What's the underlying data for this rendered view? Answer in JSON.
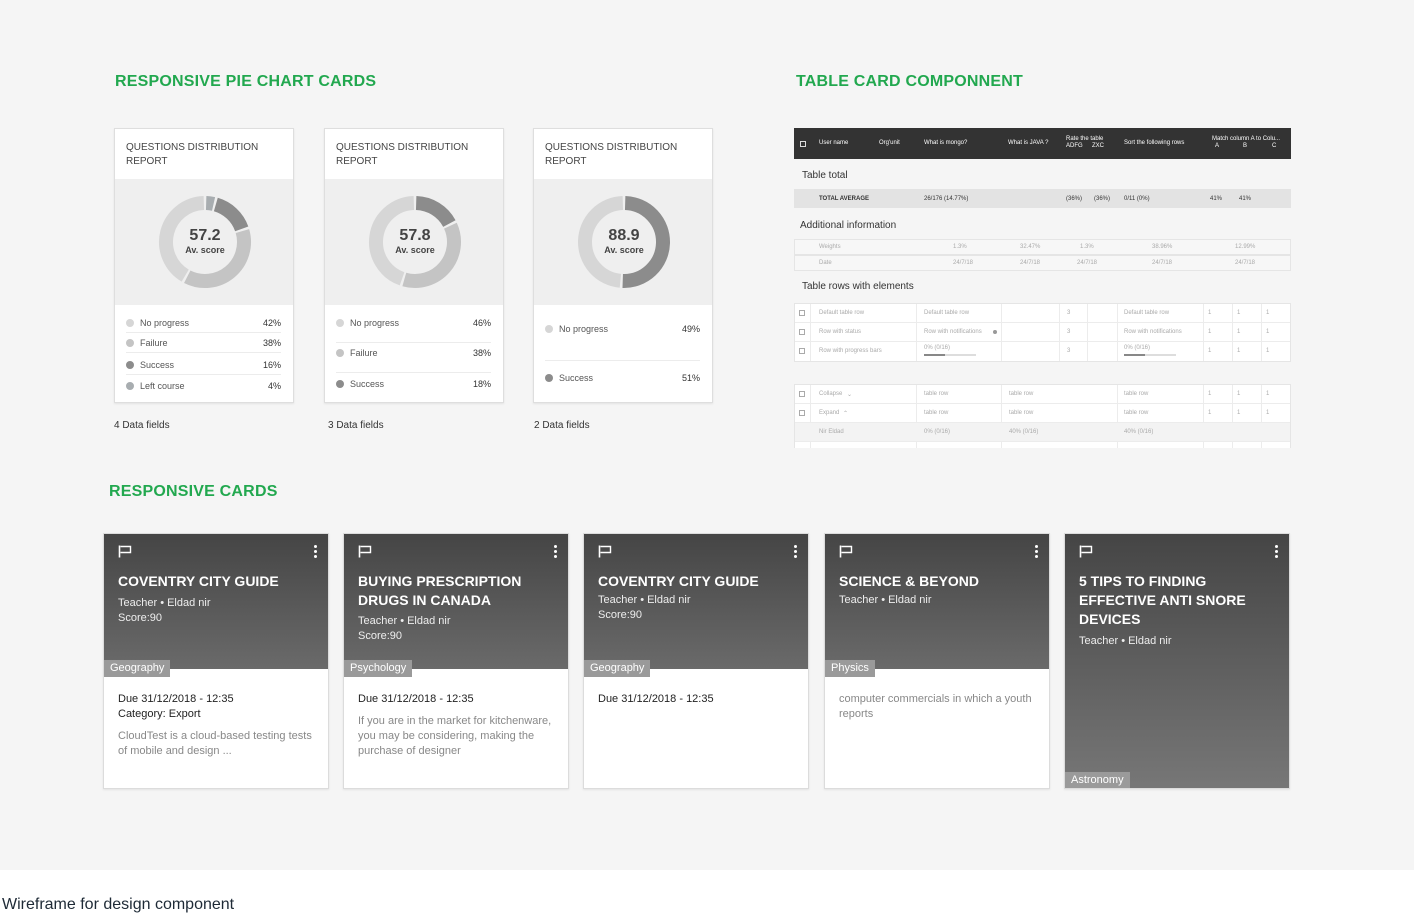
{
  "footer_title": "Wireframe for design component",
  "sections": {
    "pie": "RESPONSIVE PIE CHART CARDS",
    "table": "TABLE CARD COMPONNENT",
    "cards": "RESPONSIVE CARDS"
  },
  "pie_cards": [
    {
      "title": "QUESTIONS DISTRIBUTION REPORT",
      "score": "57.2",
      "score_label": "Av. score",
      "caption": "4 Data fields",
      "legend": [
        {
          "label": "No progress",
          "pct": "42%",
          "value": 42,
          "color": "#d6d6d6"
        },
        {
          "label": "Failure",
          "pct": "38%",
          "value": 38,
          "color": "#c4c4c4"
        },
        {
          "label": "Success",
          "pct": "16%",
          "value": 16,
          "color": "#8c8c8c"
        },
        {
          "label": "Left course",
          "pct": "4%",
          "value": 4,
          "color": "#a8adb0"
        }
      ]
    },
    {
      "title": "QUESTIONS DISTRIBUTION REPORT",
      "score": "57.8",
      "score_label": "Av. score",
      "caption": "3 Data fields",
      "legend": [
        {
          "label": "No progress",
          "pct": "46%",
          "value": 46,
          "color": "#d6d6d6"
        },
        {
          "label": "Failure",
          "pct": "38%",
          "value": 38,
          "color": "#c4c4c4"
        },
        {
          "label": "Success",
          "pct": "18%",
          "value": 18,
          "color": "#8c8c8c"
        }
      ]
    },
    {
      "title": "QUESTIONS DISTRIBUTION REPORT",
      "score": "88.9",
      "score_label": "Av. score",
      "caption": "2 Data fields",
      "legend": [
        {
          "label": "No progress",
          "pct": "49%",
          "value": 49,
          "color": "#d6d6d6"
        },
        {
          "label": "Success",
          "pct": "51%",
          "value": 51,
          "color": "#8c8c8c"
        }
      ]
    }
  ],
  "table_card": {
    "headers": [
      "User name",
      "Org'unit",
      "What is mongo?",
      "What is JAVA ?",
      "Rate the table",
      "ADFG",
      "ZXC",
      "Sort the following rows",
      "Match column A to Colu...",
      "A",
      "B",
      "C"
    ],
    "section_total": "Table total",
    "total_row": [
      "TOTAL AVERAGE",
      "26/176 (14.77%)",
      "(36%)",
      "(36%)",
      "0/11 (0%)",
      "41%",
      "41%"
    ],
    "section_info": "Additional information",
    "info_rows": [
      [
        "Weights",
        "1.3%",
        "32.47%",
        "1.3%",
        "38.96%",
        "12.99%"
      ],
      [
        "Date",
        "24/7/18",
        "24/7/18",
        "24/7/18",
        "24/7/18",
        "24/7/18"
      ]
    ],
    "section_elements": "Table rows with elements",
    "element_rows": [
      [
        "Default table row",
        "Default table row",
        "3",
        "Default table row",
        "1",
        "1",
        "1"
      ],
      [
        "Row with status",
        "Row with notifications",
        "3",
        "Row with notifications",
        "1",
        "1",
        "1"
      ],
      [
        "Row with progress bars",
        "0% (0/16)",
        "3",
        "0% (0/16)",
        "1",
        "1",
        "1"
      ]
    ],
    "collapse_rows": [
      [
        "Collapse",
        "table row",
        "table row",
        "table row",
        "1",
        "1",
        "1"
      ],
      [
        "Expand",
        "table row",
        "table row",
        "table row",
        "1",
        "1",
        "1"
      ],
      [
        "Nir Eldad",
        "0% (0/16)",
        "40% (0/16)",
        "40% (0/16)"
      ]
    ]
  },
  "cards": [
    {
      "title": "COVENTRY CITY GUIDE",
      "meta1": "Teacher • Eldad nir",
      "meta2": "Score:90",
      "tag": "Geography",
      "due": "Due 31/12/2018 - 12:35",
      "category": "Category: Export",
      "desc": "CloudTest is a cloud-based testing tests of mobile and design ..."
    },
    {
      "title": "BUYING PRESCRIPTION DRUGS IN CANADA",
      "meta1": "Teacher • Eldad nir",
      "meta2": "Score:90",
      "tag": "Psychology",
      "due": "Due 31/12/2018 - 12:35",
      "category": "",
      "desc": "If you are in the market for kitchenware, you may be considering, making the purchase of designer"
    },
    {
      "title": "COVENTRY CITY GUIDE",
      "meta1": "Teacher • Eldad nir",
      "meta2": "Score:90",
      "tag": "Geography",
      "due": "Due 31/12/2018 - 12:35",
      "category": "",
      "desc": ""
    },
    {
      "title": "SCIENCE & BEYOND",
      "meta1": "Teacher • Eldad nir",
      "meta2": "",
      "tag": "Physics",
      "due": "",
      "category": "",
      "desc": "computer commercials in which a youth reports"
    },
    {
      "title": "5 TIPS TO FINDING EFFECTIVE ANTI SNORE DEVICES",
      "meta1": "Teacher • Eldad nir",
      "meta2": "",
      "tag": "Astronomy",
      "due": "",
      "category": "",
      "desc": ""
    }
  ],
  "icons": {
    "card_flag": "flag-icon",
    "card_menu": "kebab-menu-icon",
    "checkbox": "checkbox-icon"
  }
}
